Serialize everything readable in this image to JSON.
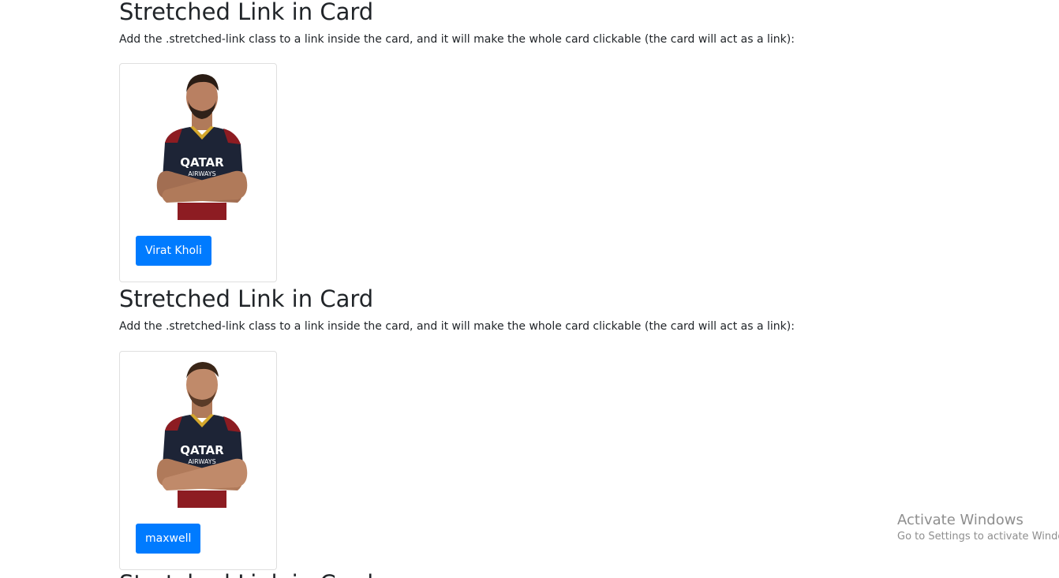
{
  "sections": [
    {
      "heading": "Stretched Link in Card",
      "description": "Add the .stretched-link class to a link inside the card, and it will make the whole card clickable (the card will act as a link):",
      "button_label": "Virat Kholi",
      "photo_icon": "player-portrait-icon"
    },
    {
      "heading": "Stretched Link in Card",
      "description": "Add the .stretched-link class to a link inside the card, and it will make the whole card clickable (the card will act as a link):",
      "button_label": "maxwell",
      "photo_icon": "player-portrait-icon"
    },
    {
      "heading": "Stretched Link in Card"
    }
  ],
  "watermark": {
    "line1": "Activate Windows",
    "line2": "Go to Settings to activate Windows."
  },
  "colors": {
    "button": "#007bff",
    "jersey_navy": "#1d2436",
    "jersey_red": "#8d1c22",
    "jersey_gold": "#d4a72c"
  }
}
